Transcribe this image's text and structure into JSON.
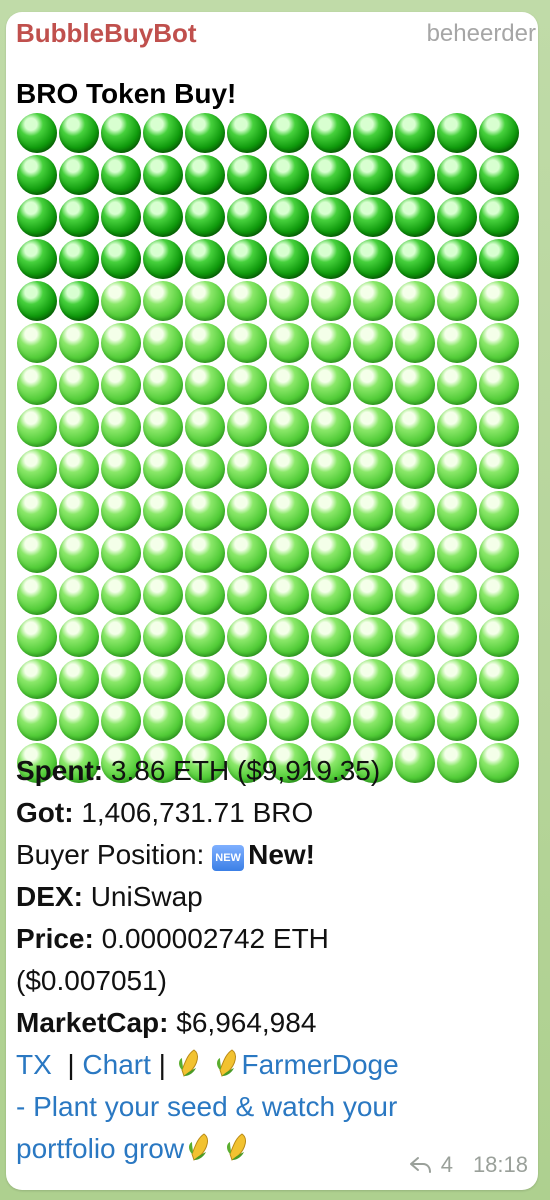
{
  "message": {
    "sender": "BubbleBuyBot",
    "role": "beheerder",
    "title": "BRO Token Buy!",
    "bubbles": {
      "dark_count": 50,
      "light_count": 142,
      "columns": 12,
      "colors": {
        "dark": "#109b0d",
        "light": "#52cc38"
      }
    },
    "details": {
      "spent_label": "Spent:",
      "spent_value": "3.86 ETH ($9,919.35)",
      "got_label": "Got:",
      "got_value": "1,406,731.71 BRO",
      "buyer_position_label": "Buyer Position:",
      "buyer_position_badge": "NEW",
      "buyer_position_value": "New!",
      "dex_label": "DEX:",
      "dex_value": "UniSwap",
      "price_label": "Price:",
      "price_value": "0.000002742 ETH",
      "price_usd": "($0.007051)",
      "marketcap_label": "MarketCap:",
      "marketcap_value": "$6,964,984"
    },
    "links": {
      "tx": "TX",
      "sep1": "|",
      "chart": "Chart",
      "sep2": "|",
      "promo": "FarmerDoge",
      "promo_line2": "- Plant your seed & watch your",
      "promo_line3": "portfolio grow"
    },
    "meta": {
      "replies": "4",
      "time": "18:18"
    }
  }
}
